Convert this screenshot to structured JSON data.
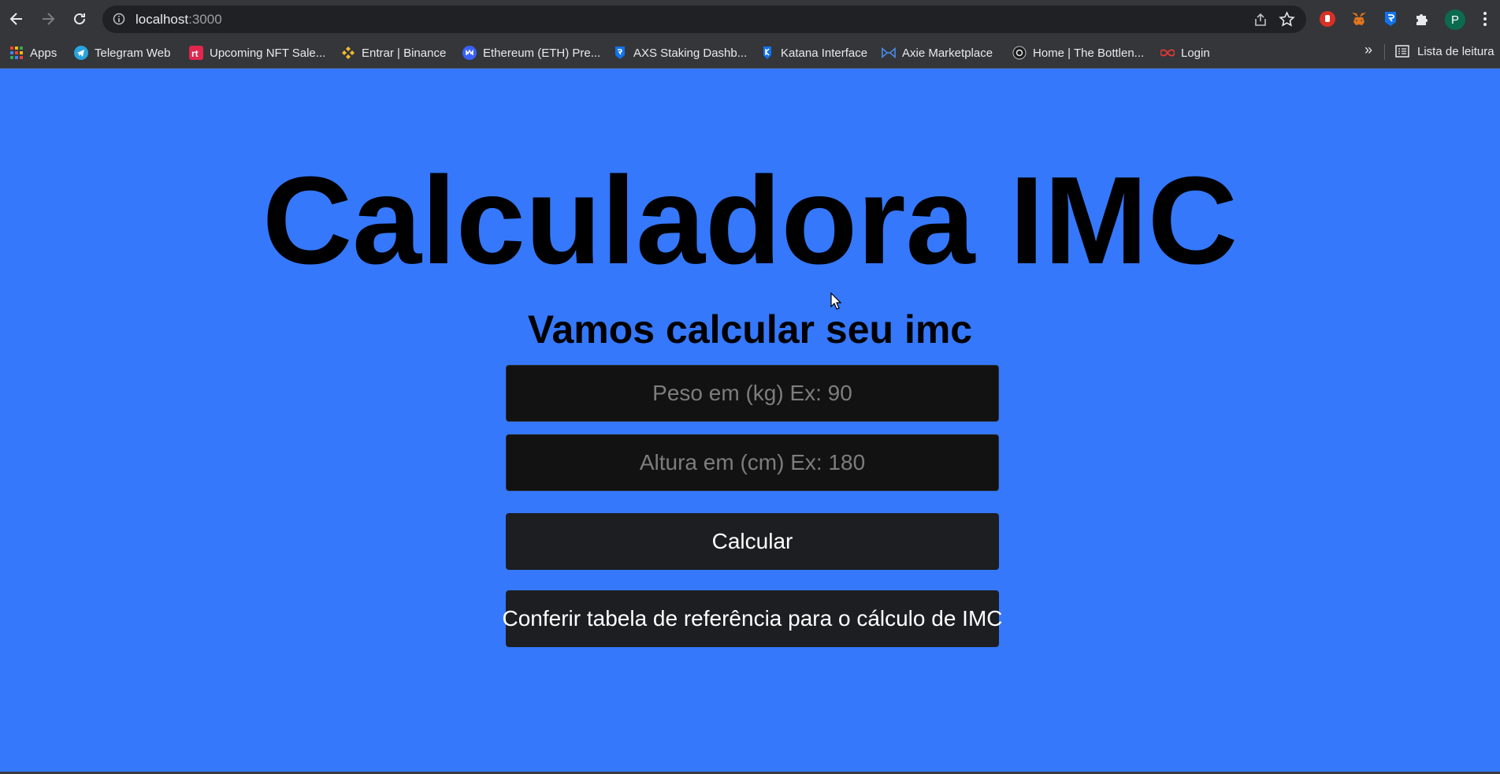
{
  "browser": {
    "url_host": "localhost",
    "url_port": ":3000",
    "profile_initial": "P",
    "bookmarks": [
      {
        "label": "Apps",
        "icon": "apps-grid-icon"
      },
      {
        "label": "Telegram Web",
        "icon": "telegram-icon"
      },
      {
        "label": "Upcoming NFT Sale...",
        "icon": "rt-icon"
      },
      {
        "label": "Entrar | Binance",
        "icon": "binance-icon"
      },
      {
        "label": "Ethereum (ETH) Pre...",
        "icon": "coinmarketcap-icon"
      },
      {
        "label": "AXS Staking Dashb...",
        "icon": "ronin-icon"
      },
      {
        "label": "Katana Interface",
        "icon": "katana-icon"
      },
      {
        "label": "Axie Marketplace",
        "icon": "axie-icon"
      },
      {
        "label": "Home | The Bottlen...",
        "icon": "bottleneck-icon"
      },
      {
        "label": "Login",
        "icon": "infinity-icon"
      }
    ],
    "more_bookmarks": "»",
    "reading_list": "Lista de leitura"
  },
  "page": {
    "title": "Calculadora IMC",
    "subtitle": "Vamos calcular seu imc",
    "weight_placeholder": "Peso em (kg) Ex: 90",
    "height_placeholder": "Altura em (cm) Ex: 180",
    "weight_value": "",
    "height_value": "",
    "calculate_label": "Calcular",
    "reference_label": "Conferir tabela de referência para o cálculo de IMC"
  },
  "colors": {
    "background": "#3578fc",
    "field": "#121212",
    "button": "#1d1e21",
    "chrome": "#35363a"
  }
}
